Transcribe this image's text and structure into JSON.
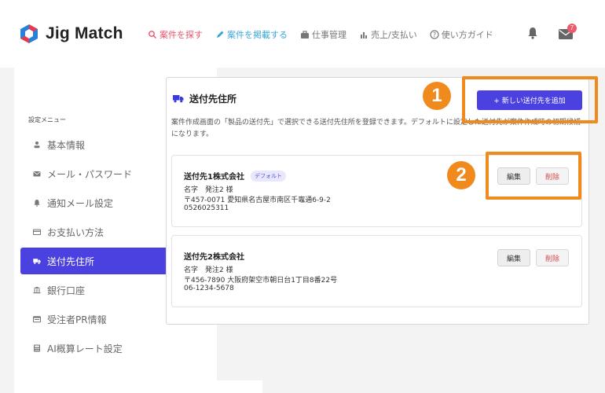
{
  "header": {
    "app_name": "Jig Match",
    "nav": [
      {
        "label": "案件を探す",
        "icon": "search-icon",
        "color": "#e8536b"
      },
      {
        "label": "案件を掲載する",
        "icon": "pencil-icon",
        "color": "#3aa6d6"
      },
      {
        "label": "仕事管理",
        "icon": "briefcase-icon",
        "color": "#777777"
      },
      {
        "label": "売上/支払い",
        "icon": "bar-chart-icon",
        "color": "#777777"
      },
      {
        "label": "使い方ガイド",
        "icon": "question-icon",
        "color": "#777777"
      }
    ],
    "notification_icon": "bell-icon",
    "mail_icon": "mail-icon",
    "mail_badge": "7"
  },
  "sidebar": {
    "title": "設定メニュー",
    "items": [
      {
        "label": "基本情報",
        "icon": "user-icon",
        "active": false
      },
      {
        "label": "メール・パスワード",
        "icon": "envelope-icon",
        "active": false
      },
      {
        "label": "通知メール設定",
        "icon": "bell-icon",
        "active": false
      },
      {
        "label": "お支払い方法",
        "icon": "credit-card-icon",
        "active": false
      },
      {
        "label": "送付先住所",
        "icon": "truck-icon",
        "active": true
      },
      {
        "label": "銀行口座",
        "icon": "bank-icon",
        "active": false
      },
      {
        "label": "受注者PR情報",
        "icon": "id-card-icon",
        "active": false
      },
      {
        "label": "AI概算レート設定",
        "icon": "calculator-icon",
        "active": false
      }
    ]
  },
  "main": {
    "title": "送付先住所",
    "title_icon": "truck-icon",
    "add_button": "+ 新しい送付先を追加",
    "description": "案件作成画面の「製品の送付先」で選択できる送付先住所を登録できます。デフォルトに設定した送付先が案件作成時の初期候補になります。",
    "addresses": [
      {
        "company": "送付先1株式会社",
        "default_label": "デフォルト",
        "name": "名字　発注2 様",
        "address": "〒457-0071 愛知県名古屋市南区千竈通6-9-2",
        "phone": "0526025311",
        "edit_label": "編集",
        "delete_label": "削除"
      },
      {
        "company": "送付先2株式会社",
        "default_label": "",
        "name": "名字　発注2 様",
        "address": "〒456-7890 大阪府架空市朝日台1丁目8番22号",
        "phone": "06-1234-5678",
        "edit_label": "編集",
        "delete_label": "削除"
      }
    ]
  },
  "annotations": {
    "step1": "1",
    "step2": "2",
    "color": "#f08a1c"
  },
  "colors": {
    "accent": "#4a41e0",
    "delete_text": "#d24b4b",
    "badge": "#ec5a6b"
  }
}
